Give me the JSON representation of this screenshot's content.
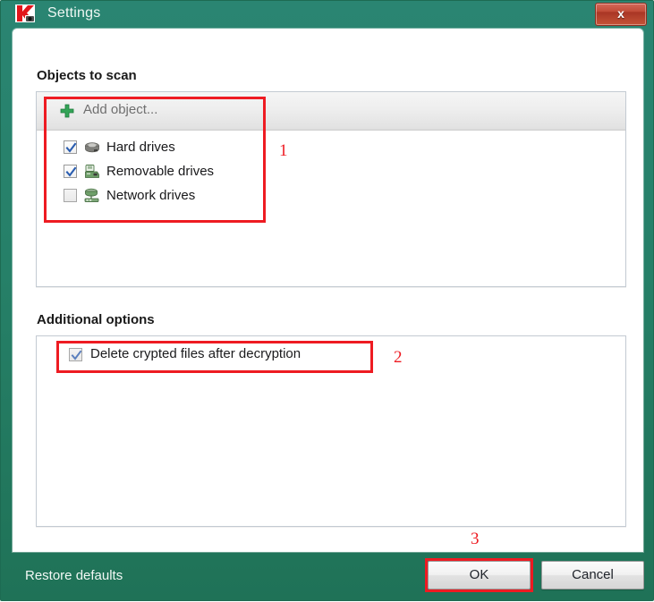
{
  "window": {
    "title": "Settings",
    "logo_icon": "kaspersky-k-logo-icon",
    "close_label": "x",
    "frame_color": "#268068",
    "accent_red": "#ee1b22"
  },
  "sections": [
    {
      "heading": "Objects to scan",
      "add_object": {
        "label": "Add object...",
        "icon": "plus-icon"
      },
      "items": [
        {
          "label": "Hard drives",
          "checked": true,
          "icon": "hard-drive-icon"
        },
        {
          "label": "Removable drives",
          "checked": true,
          "icon": "removable-drive-icon"
        },
        {
          "label": "Network drives",
          "checked": false,
          "icon": "network-drive-icon"
        }
      ]
    },
    {
      "heading": "Additional options",
      "options": [
        {
          "label": "Delete crypted files after decryption",
          "checked": true
        }
      ]
    }
  ],
  "footer": {
    "restore_defaults_label": "Restore defaults",
    "ok_label": "OK",
    "cancel_label": "Cancel"
  },
  "annotations": [
    {
      "number": "1"
    },
    {
      "number": "2"
    },
    {
      "number": "3"
    }
  ]
}
